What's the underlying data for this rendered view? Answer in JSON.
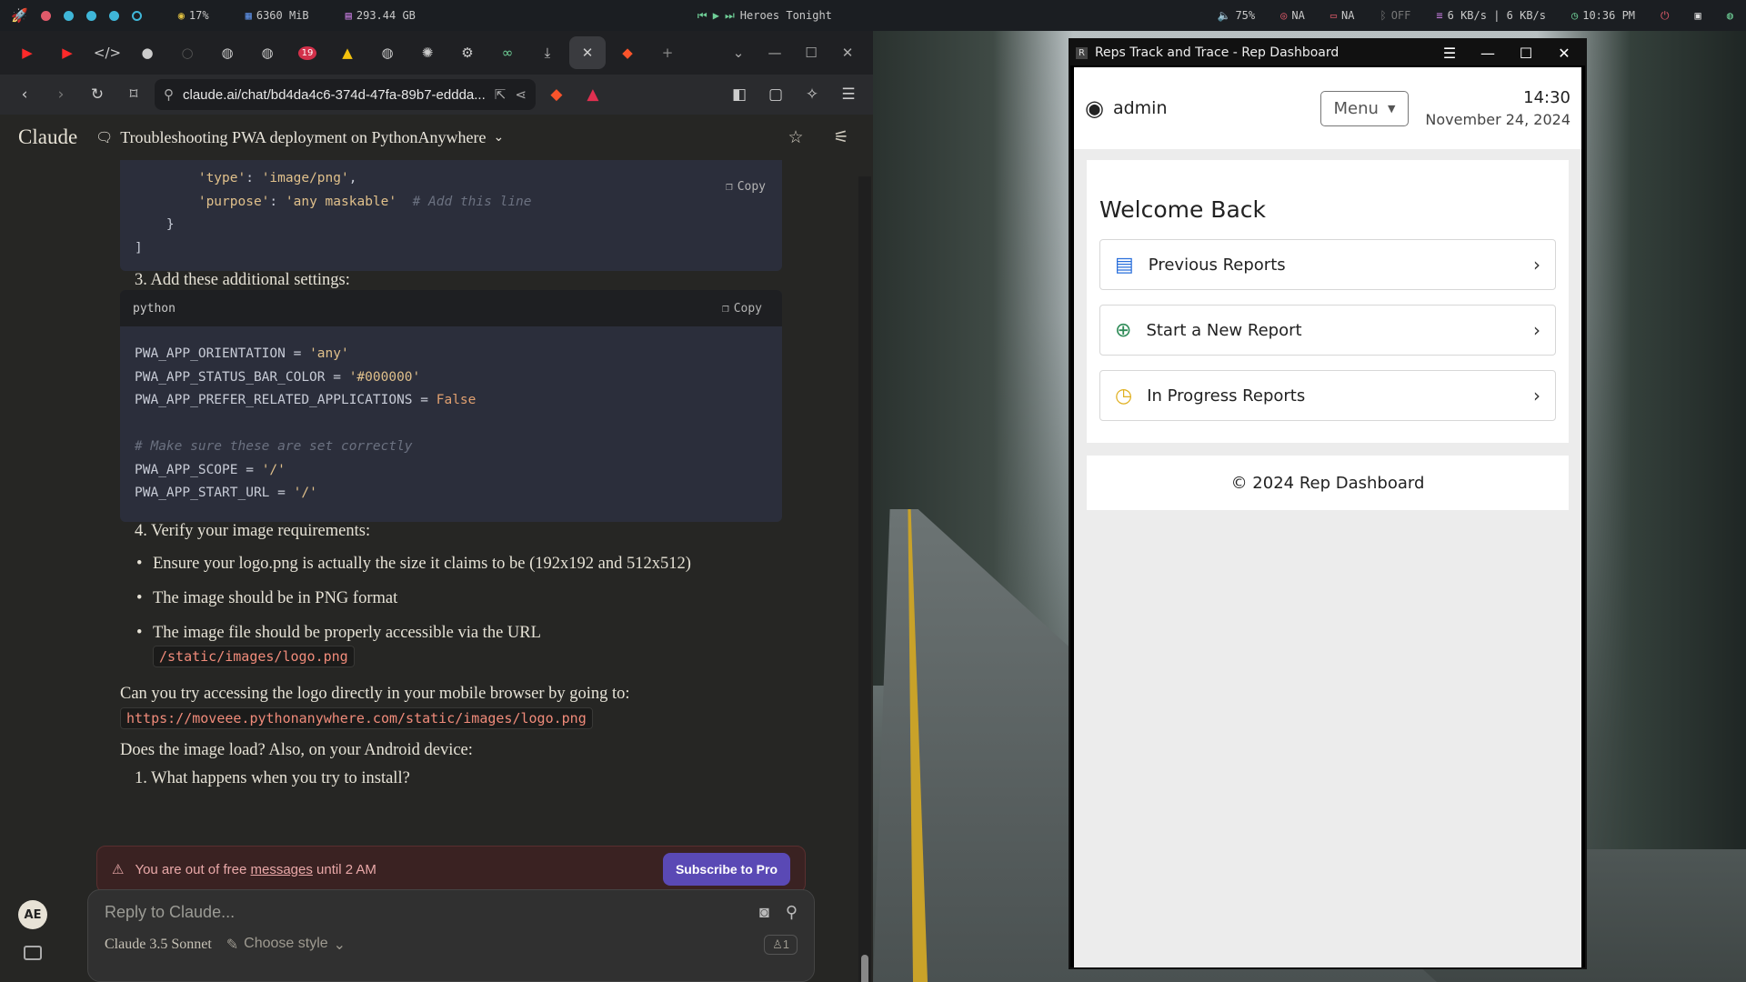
{
  "colors": {
    "accent": "#5a49b5",
    "warning_bg": "#3a2222",
    "code_bg": "#2b2e3b"
  },
  "sysbar": {
    "cpu": "17%",
    "ram": "6360 MiB",
    "disk": "293.44 GB",
    "media": "Heroes Tonight",
    "volume": "75%",
    "net1": "NA",
    "net2": "NA",
    "bluetooth": "OFF",
    "speed": "6 KB/s | 6 KB/s",
    "clock": "10:36 PM"
  },
  "browser": {
    "url": "claude.ai/chat/bd4da4c6-374d-47fa-89b7-eddda...",
    "tab_badge": "19"
  },
  "claude": {
    "logo": "Claude",
    "title": "Troubleshooting PWA deployment on PythonAnywhere",
    "copy_label": "Copy",
    "code1_lines": [
      {
        "indent": "        ",
        "parts": [
          {
            "t": "'type'",
            "c": "s"
          },
          {
            "t": ": ",
            "c": "op"
          },
          {
            "t": "'image/png'",
            "c": "s"
          },
          {
            "t": ",",
            "c": "op"
          }
        ]
      },
      {
        "indent": "        ",
        "parts": [
          {
            "t": "'purpose'",
            "c": "s"
          },
          {
            "t": ": ",
            "c": "op"
          },
          {
            "t": "'any maskable'",
            "c": "s"
          },
          {
            "t": "  # Add this line",
            "c": "c"
          }
        ]
      },
      {
        "indent": "    ",
        "parts": [
          {
            "t": "}",
            "c": "op"
          }
        ]
      },
      {
        "indent": "",
        "parts": [
          {
            "t": "]",
            "c": "op"
          }
        ]
      }
    ],
    "step3": "3. Add these additional settings:",
    "code2_lang": "python",
    "code2_lines": [
      {
        "indent": "",
        "parts": [
          {
            "t": "PWA_APP_ORIENTATION = ",
            "c": "op"
          },
          {
            "t": "'any'",
            "c": "s"
          }
        ]
      },
      {
        "indent": "",
        "parts": [
          {
            "t": "PWA_APP_STATUS_BAR_COLOR = ",
            "c": "op"
          },
          {
            "t": "'#000000'",
            "c": "s"
          }
        ]
      },
      {
        "indent": "",
        "parts": [
          {
            "t": "PWA_APP_PREFER_RELATED_APPLICATIONS = ",
            "c": "op"
          },
          {
            "t": "False",
            "c": "k"
          }
        ]
      },
      {
        "indent": "",
        "parts": [
          {
            "t": "",
            "c": "op"
          }
        ]
      },
      {
        "indent": "",
        "parts": [
          {
            "t": "# Make sure these are set correctly",
            "c": "c"
          }
        ]
      },
      {
        "indent": "",
        "parts": [
          {
            "t": "PWA_APP_SCOPE = ",
            "c": "op"
          },
          {
            "t": "'/'",
            "c": "s"
          }
        ]
      },
      {
        "indent": "",
        "parts": [
          {
            "t": "PWA_APP_START_URL = ",
            "c": "op"
          },
          {
            "t": "'/'",
            "c": "s"
          }
        ]
      }
    ],
    "step4": "4. Verify your image requirements:",
    "bullets": [
      "Ensure your logo.png is actually the size it claims to be (192x192 and 512x512)",
      "The image should be in PNG format",
      "The image file should be properly accessible via the URL"
    ],
    "logo_path": "/static/images/logo.png",
    "try_text": "Can you try accessing the logo directly in your mobile browser by going to:",
    "logo_url": "https://moveee.pythonanywhere.com/static/images/logo.png",
    "question": "Does the image load? Also, on your Android device:",
    "step_q1": "1. What happens when you try to install?",
    "limit_pre": "You are out of free ",
    "limit_link": "messages",
    "limit_post": " until 2 AM",
    "subscribe": "Subscribe to Pro",
    "reply_placeholder": "Reply to Claude...",
    "model": "Claude 3.5 Sonnet",
    "style": "Choose style",
    "count": "1",
    "avatar": "AE"
  },
  "dashboard": {
    "window_title": "Reps Track and Trace - Rep Dashboard",
    "user": "admin",
    "menu": "Menu",
    "time": "14:30",
    "date": "November 24, 2024",
    "welcome": "Welcome Back",
    "cards": [
      {
        "label": "Previous Reports",
        "icon": "document-icon",
        "color": "#2a6fdb"
      },
      {
        "label": "Start a New Report",
        "icon": "plus-circle-icon",
        "color": "#2e8b57"
      },
      {
        "label": "In Progress Reports",
        "icon": "clock-icon",
        "color": "#e0b020"
      }
    ],
    "footer": "© 2024 Rep Dashboard"
  }
}
